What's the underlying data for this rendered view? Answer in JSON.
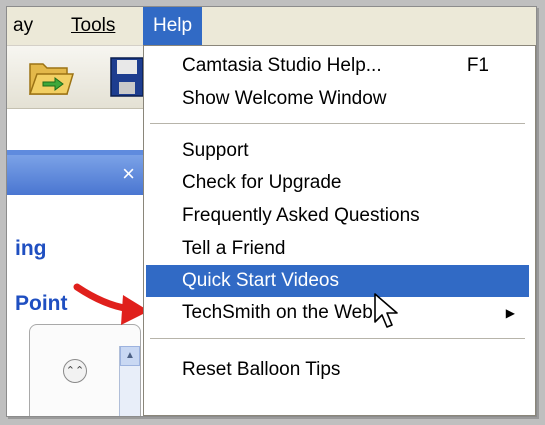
{
  "menubar": {
    "partial_item": "ay",
    "tools": "Tools",
    "help": "Help"
  },
  "left_panel": {
    "close_glyph": "×",
    "link_1": "ing",
    "link_2": "Point",
    "collapse_glyph": "⌃⌃",
    "scroll_up_glyph": "▲"
  },
  "help_menu": {
    "items": [
      {
        "label": "Camtasia Studio Help...",
        "shortcut": "F1"
      },
      {
        "label": "Show Welcome Window"
      },
      {
        "label": "Support"
      },
      {
        "label": "Check for Upgrade"
      },
      {
        "label": "Frequently Asked Questions"
      },
      {
        "label": "Tell a Friend"
      },
      {
        "label": "Quick Start Videos"
      },
      {
        "label": "TechSmith on the Web",
        "submenu_glyph": "▶"
      },
      {
        "label": "Reset Balloon Tips"
      }
    ]
  },
  "colors": {
    "highlight": "#316ac5",
    "arrow": "#e0201c",
    "link": "#1f4fc1"
  },
  "icons": [
    "folder-open-icon",
    "save-disk-icon",
    "mouse-cursor-icon",
    "red-arrow-icon"
  ]
}
